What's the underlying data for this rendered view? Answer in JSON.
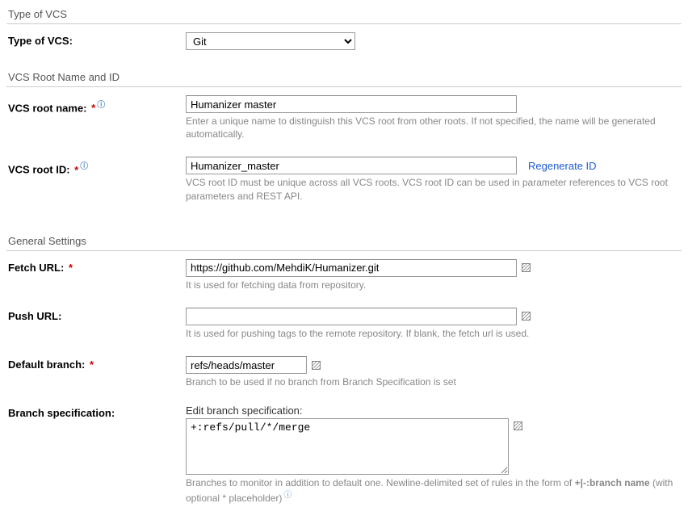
{
  "sections": {
    "type_of_vcs": "Type of VCS",
    "name_and_id": "VCS Root Name and ID",
    "general": "General Settings"
  },
  "vcs_type": {
    "label": "Type of VCS:",
    "value": "Git"
  },
  "root_name": {
    "label": "VCS root name:",
    "value": "Humanizer master",
    "help": "Enter a unique name to distinguish this VCS root from other roots. If not specified, the name will be generated automatically."
  },
  "root_id": {
    "label": "VCS root ID:",
    "value": "Humanizer_master",
    "regenerate_label": "Regenerate ID",
    "help": "VCS root ID must be unique across all VCS roots. VCS root ID can be used in parameter references to VCS root parameters and REST API."
  },
  "fetch_url": {
    "label": "Fetch URL:",
    "value": "https://github.com/MehdiK/Humanizer.git",
    "help": "It is used for fetching data from repository."
  },
  "push_url": {
    "label": "Push URL:",
    "value": "",
    "help": "It is used for pushing tags to the remote repository. If blank, the fetch url is used."
  },
  "default_branch": {
    "label": "Default branch:",
    "value": "refs/heads/master",
    "help": "Branch to be used if no branch from Branch Specification is set"
  },
  "branch_spec": {
    "label": "Branch specification:",
    "sublabel": "Edit branch specification:",
    "value": "+:refs/pull/*/merge",
    "help_prefix": "Branches to monitor in addition to default one. Newline-delimited set of rules in the form of ",
    "help_bold": "+|-:branch name",
    "help_suffix": " (with optional * placeholder)"
  }
}
